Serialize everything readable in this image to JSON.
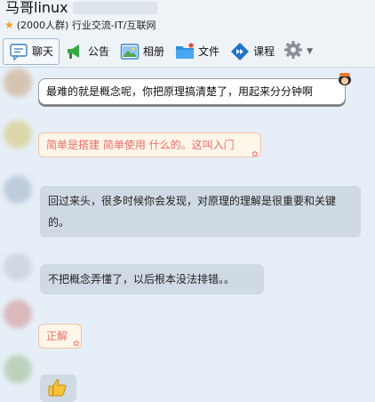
{
  "group": {
    "name": "马哥linux",
    "subtitle": "(2000人群) 行业交流-IT/互联网"
  },
  "toolbar": {
    "tabs": [
      {
        "id": "chat",
        "label": "聊天",
        "icon": "chat-icon",
        "active": true
      },
      {
        "id": "announce",
        "label": "公告",
        "icon": "megaphone-icon"
      },
      {
        "id": "album",
        "label": "相册",
        "icon": "photo-icon"
      },
      {
        "id": "files",
        "label": "文件",
        "icon": "folder-icon"
      },
      {
        "id": "course",
        "label": "课程",
        "icon": "course-icon"
      }
    ],
    "more_icon": "gear-icon"
  },
  "messages": [
    {
      "id": 1,
      "style": "white-cartoon",
      "text": "最难的就是概念呢，你把原理搞清楚了，用起来分分钟啊"
    },
    {
      "id": 2,
      "style": "peach",
      "text": "简单是搭建 简单使用 什么的。这叫入门"
    },
    {
      "id": 3,
      "style": "plain",
      "text": "回过来头，很多时候你会发现，对原理的理解是很重要和关键的。"
    },
    {
      "id": 4,
      "style": "plain",
      "text": "不把概念弄懂了，以后根本没法排错。。"
    },
    {
      "id": 5,
      "style": "peach",
      "text": "正解"
    },
    {
      "id": 6,
      "style": "plain",
      "emoji": "thumbs-up-icon"
    }
  ],
  "colors": {
    "accent": "#1e88d8",
    "peach_text": "#e6706a",
    "bubble_grey": "#d0dae4"
  }
}
